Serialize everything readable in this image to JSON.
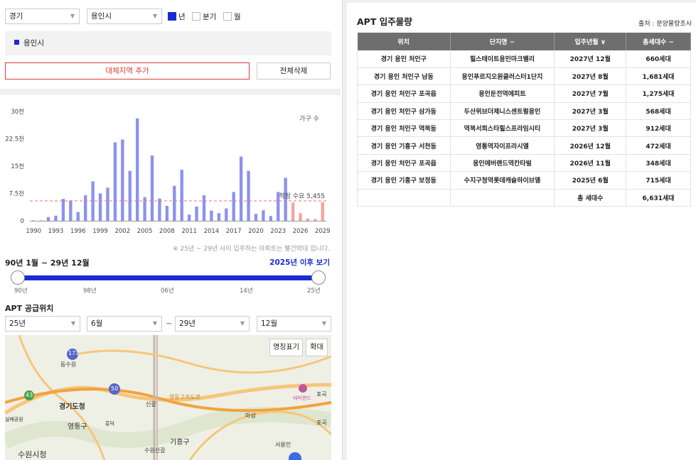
{
  "filters": {
    "province": "경기",
    "city": "용인시",
    "period_options": [
      {
        "label": "년",
        "checked": true
      },
      {
        "label": "분기",
        "checked": false
      },
      {
        "label": "월",
        "checked": false
      }
    ]
  },
  "selected_region": "용인시",
  "buttons": {
    "add_region": "대체지역 추가",
    "delete_all": "전체삭제"
  },
  "chart_data": {
    "type": "bar",
    "title": "",
    "series_label": "가구 수",
    "ylim": [
      0,
      30000
    ],
    "y_ticks": [
      {
        "value": 0,
        "label": "0"
      },
      {
        "value": 7500,
        "label": "7.5천"
      },
      {
        "value": 15000,
        "label": "15천"
      },
      {
        "value": 22500,
        "label": "22.5천"
      },
      {
        "value": 30000,
        "label": "30천"
      }
    ],
    "x_ticks": [
      "1990",
      "1993",
      "1996",
      "1999",
      "2002",
      "2005",
      "2008",
      "2011",
      "2014",
      "2017",
      "2020",
      "2023",
      "2026",
      "2029"
    ],
    "years": [
      1990,
      1991,
      1992,
      1993,
      1994,
      1995,
      1996,
      1997,
      1998,
      1999,
      2000,
      2001,
      2002,
      2003,
      2004,
      2005,
      2006,
      2007,
      2008,
      2009,
      2010,
      2011,
      2012,
      2013,
      2014,
      2015,
      2016,
      2017,
      2018,
      2019,
      2020,
      2021,
      2022,
      2023,
      2024,
      2025,
      2026,
      2027,
      2028,
      2029
    ],
    "values": [
      100,
      100,
      1000,
      1400,
      6000,
      5600,
      2400,
      7000,
      10800,
      7500,
      9100,
      21500,
      22300,
      13700,
      28100,
      6500,
      17900,
      6100,
      4100,
      9600,
      14000,
      1700,
      3900,
      7000,
      2800,
      2100,
      3400,
      7900,
      17600,
      13700,
      1900,
      2900,
      1300,
      7900,
      11800,
      5000,
      2100,
      660,
      500,
      5100
    ],
    "highlight_from_year": 2025,
    "proper_demand": {
      "label": "적정 수요 5,455",
      "value": 5455
    },
    "colors": {
      "past": "#8b93ee",
      "future": "#f4a49d",
      "demand_line": "#e57373"
    },
    "grid": false
  },
  "chart_note": "※ 25년 ~ 29년 사이 입주하는 아파트는 빨간막대 입니다.",
  "range": {
    "title": "90년 1월 ~ 29년 12월",
    "after_link": "2025년 이후 보기",
    "labels": [
      "90년",
      "98년",
      "06년",
      "14년",
      "25년"
    ]
  },
  "supply": {
    "title": "APT 공급위치",
    "from_year": "25년",
    "from_month": "6월",
    "tilde": "~",
    "to_year": "29년",
    "to_month": "12월"
  },
  "map": {
    "btn_names": "명칭표기",
    "btn_zoom": "확대",
    "labels": [
      "경기도청",
      "영통구",
      "기흥구",
      "수원시청",
      "동수원",
      "신갈",
      "흥덕",
      "마성",
      "포곡",
      "에버랜드",
      "서용인",
      "수원신갈",
      "영동고속도로",
      "실패공원",
      "포곡"
    ],
    "route_labels": [
      "171",
      "43",
      "50"
    ]
  },
  "table": {
    "title": "APT 입주물량",
    "source": "출처 : 분양물량조사",
    "headers": [
      "위치",
      "단지명 −",
      "입주년월 ∨",
      "총세대수 −"
    ],
    "rows": [
      [
        "경기 용인 처인구",
        "힐스테이트용인마크밸리",
        "2027년 12월",
        "660세대"
      ],
      [
        "경기 용인 처인구 남동",
        "용인푸르지오원클러스터1단지",
        "2027년 8월",
        "1,681세대"
      ],
      [
        "경기 용인 처인구 포곡읍",
        "용인둔전역에피트",
        "2027년 7월",
        "1,275세대"
      ],
      [
        "경기 용인 처인구 삼가동",
        "두산위브더제니스센트럴용인",
        "2027년 3월",
        "568세대"
      ],
      [
        "경기 용인 처인구 역북동",
        "역북서희스타힐스프라임시티",
        "2027년 3월",
        "912세대"
      ],
      [
        "경기 용인 기흥구 서천동",
        "영통역자이프라시엘",
        "2026년 12월",
        "472세대"
      ],
      [
        "경기 용인 처인구 포곡읍",
        "용인에버랜드역칸타빌",
        "2026년 11월",
        "348세대"
      ],
      [
        "경기 용인 기흥구 보정동",
        "수지구청역롯데캐슬하이브엘",
        "2025년 6월",
        "715세대"
      ]
    ],
    "total_label": "총 세대수",
    "total_value": "6,631세대"
  }
}
